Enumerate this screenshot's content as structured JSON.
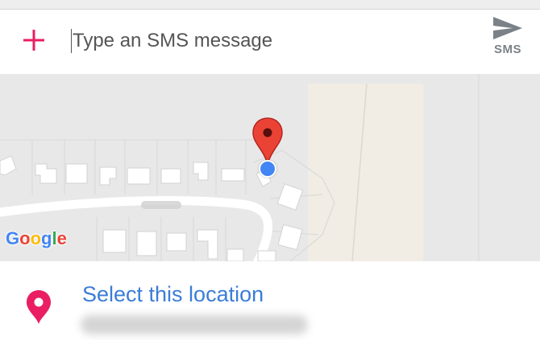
{
  "composer": {
    "add_icon": "plus-icon",
    "placeholder": "Type an SMS message",
    "send_icon": "send-icon",
    "send_label": "SMS"
  },
  "map": {
    "logo": {
      "letters": [
        "G",
        "o",
        "o",
        "g",
        "l",
        "e"
      ]
    },
    "pin_icon": "map-marker-icon",
    "my_location_icon": "my-location-dot-icon"
  },
  "location": {
    "icon": "location-pin-icon",
    "title": "Select this location"
  },
  "colors": {
    "accent": "#e91e63",
    "link_blue": "#3b7dd8",
    "map_background": "#e8e8e8",
    "pin_red": "#ea4335",
    "location_dot": "#4285f4",
    "send_gray": "#7a8288"
  }
}
